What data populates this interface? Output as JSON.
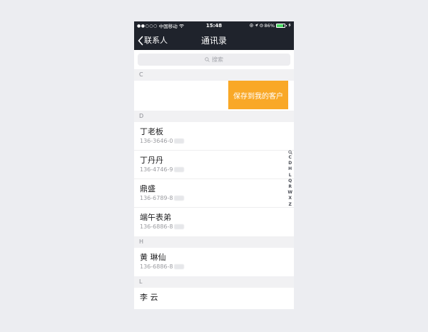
{
  "status_bar": {
    "signal": "●●○○○",
    "carrier": "中国移动",
    "time": "15:48",
    "battery_pct": "86%",
    "battery_level": 0.86,
    "icons": [
      "wifi-icon",
      "location-icon",
      "alarm-icon",
      "battery-icon",
      "charging-icon"
    ]
  },
  "nav": {
    "back_label": "联系人",
    "title": "通讯录"
  },
  "search": {
    "placeholder": "搜索"
  },
  "sections": [
    {
      "letter": "C",
      "save_action": "保存到我的客户"
    },
    {
      "letter": "D",
      "contacts": [
        {
          "name": "丁老板",
          "phone": "136-3646-0"
        },
        {
          "name": "丁丹丹",
          "phone": "136-4746-9"
        },
        {
          "name": "鼎盛",
          "phone": "136-6789-8"
        },
        {
          "name": "端午表弟",
          "phone": "136-6886-8"
        }
      ]
    },
    {
      "letter": "H",
      "contacts": [
        {
          "name": "黄 琳仙",
          "phone": "136-6886-8"
        }
      ]
    },
    {
      "letter": "L",
      "contacts": [
        {
          "name": "李 云"
        }
      ]
    }
  ],
  "index_letters": [
    "C",
    "D",
    "H",
    "L",
    "Q",
    "R",
    "W",
    "X",
    "Z"
  ],
  "colors": {
    "nav_background": "#1f232c",
    "action_orange": "#f9a827",
    "page_background": "#ecedf1"
  }
}
